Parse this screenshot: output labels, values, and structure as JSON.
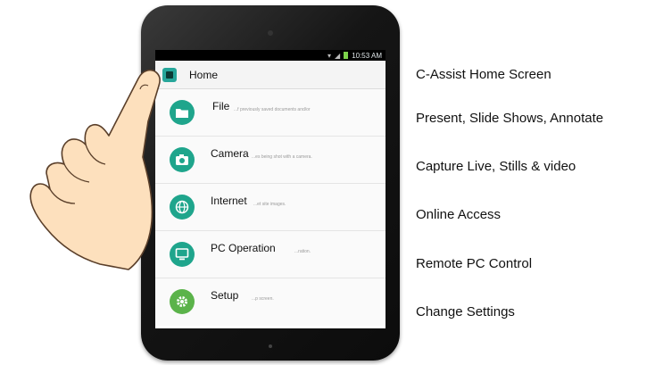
{
  "status": {
    "time": "10:53 AM"
  },
  "app": {
    "title": "Home"
  },
  "menu": [
    {
      "label": "File",
      "desc": "...f previously saved documents and/or",
      "icon": "folder-icon",
      "color": "#1fa58c"
    },
    {
      "label": "Camera",
      "desc": "...es being shot with a camera.",
      "icon": "camera-icon",
      "color": "#1fa58c"
    },
    {
      "label": "Internet",
      "desc": "...et site images.",
      "icon": "globe-icon",
      "color": "#1fa58c"
    },
    {
      "label": "PC Operation",
      "desc": "...ration.",
      "icon": "monitor-icon",
      "color": "#1fa58c"
    },
    {
      "label": "Setup",
      "desc": "...p screen.",
      "icon": "gear-icon",
      "color": "#5bb34a"
    }
  ],
  "captions": [
    "C-Assist Home Screen",
    "Present, Slide Shows, Annotate",
    "Capture Live, Stills & video",
    "Online Access",
    "Remote PC Control",
    "Change Settings"
  ]
}
